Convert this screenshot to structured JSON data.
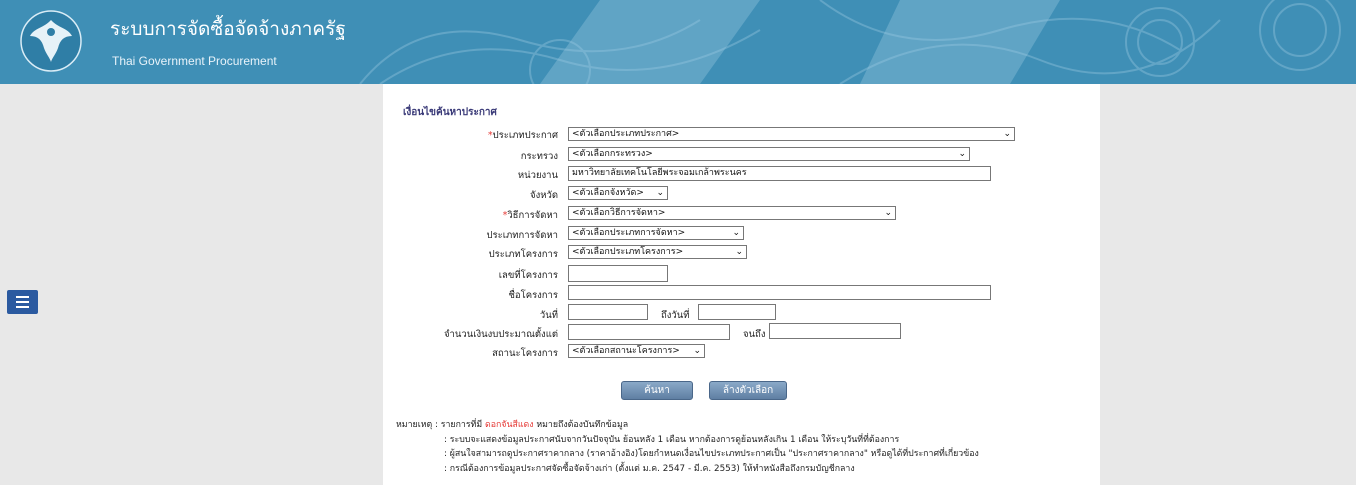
{
  "header": {
    "title_th": "ระบบการจัดซื้อจัดจ้างภาครัฐ",
    "title_en": "Thai Government Procurement",
    "logo_icon": "garuda-seal-icon",
    "colors": {
      "header_bg": "#3f8fb6",
      "button": "#6f8fb2",
      "required": "#e53935"
    }
  },
  "menu": {
    "icon": "hamburger-menu-icon"
  },
  "form": {
    "section_title": "เงื่อนไขค้นหาประกาศ",
    "fields": {
      "announcement_type": {
        "label": "ประเภทประกาศ",
        "value": "<ตัวเลือกประเภทประกาศ>"
      },
      "ministry": {
        "label": "กระทรวง",
        "value": "<ตัวเลือกกระทรวง>"
      },
      "agency": {
        "label": "หน่วยงาน",
        "value": "มหาวิทยาลัยเทคโนโลยีพระจอมเกล้าพระนคร"
      },
      "province": {
        "label": "จังหวัด",
        "value": "<ตัวเลือกจังหวัด>"
      },
      "procurement_method": {
        "label": "วิธีการจัดหา",
        "value": "<ตัวเลือกวิธีการจัดหา>"
      },
      "procurement_type": {
        "label": "ประเภทการจัดหา",
        "value": "<ตัวเลือกประเภทการจัดหา>"
      },
      "project_type": {
        "label": "ประเภทโครงการ",
        "value": "<ตัวเลือกประเภทโครงการ>"
      },
      "project_number": {
        "label": "เลขที่โครงการ",
        "value": ""
      },
      "project_name": {
        "label": "ชื่อโครงการ",
        "value": ""
      },
      "date_from": {
        "label": "วันที่",
        "value": ""
      },
      "date_to": {
        "label": "ถึงวันที่",
        "value": ""
      },
      "budget_from": {
        "label": "จำนวนเงินงบประมาณตั้งแต่",
        "value": ""
      },
      "budget_to": {
        "label": "จนถึง",
        "value": ""
      },
      "project_status": {
        "label": "สถานะโครงการ",
        "value": "<ตัวเลือกสถานะโครงการ>"
      }
    },
    "required_mark": "*",
    "buttons": {
      "search": "ค้นหา",
      "clear": "ล้างตัวเลือก"
    }
  },
  "notes": {
    "prefix": "หมายเหตุ : รายการที่มี ",
    "highlight": "ดอกจันสีแดง",
    "suffix": " หมายถึงต้องบันทึกข้อมูล",
    "lines": [
      ": ระบบจะแสดงข้อมูลประกาศนับจากวันปัจจุบัน ย้อนหลัง 1 เดือน หากต้องการดูย้อนหลังเกิน 1 เดือน ให้ระบุวันที่ที่ต้องการ",
      ": ผู้สนใจสามารถดูประกาศราคากลาง (ราคาอ้างอิง)โดยกำหนดเงื่อนไขประเภทประกาศเป็น \"ประกาศราคากลาง\" หรือดูได้ที่ประกาศที่เกี่ยวข้อง",
      ": กรณีต้องการข้อมูลประกาศจัดซื้อจัดจ้างเก่า (ตั้งแต่ ม.ค. 2547 - มี.ค. 2553) ให้ทำหนังสือถึงกรมบัญชีกลาง"
    ]
  }
}
